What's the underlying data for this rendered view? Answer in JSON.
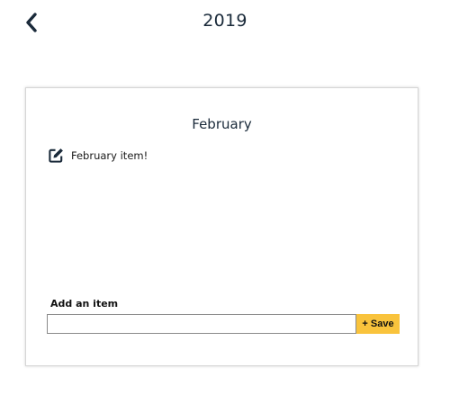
{
  "header": {
    "title": "2019",
    "back_icon": "chevron-left-icon"
  },
  "card": {
    "title": "February",
    "items": [
      {
        "icon": "edit-icon",
        "text": "February item!"
      }
    ],
    "add_item": {
      "label": "Add an item",
      "input_value": "",
      "input_placeholder": "",
      "save_label": "+ Save"
    }
  },
  "colors": {
    "accent": "#f9c33c",
    "text": "#1a2a3a"
  }
}
